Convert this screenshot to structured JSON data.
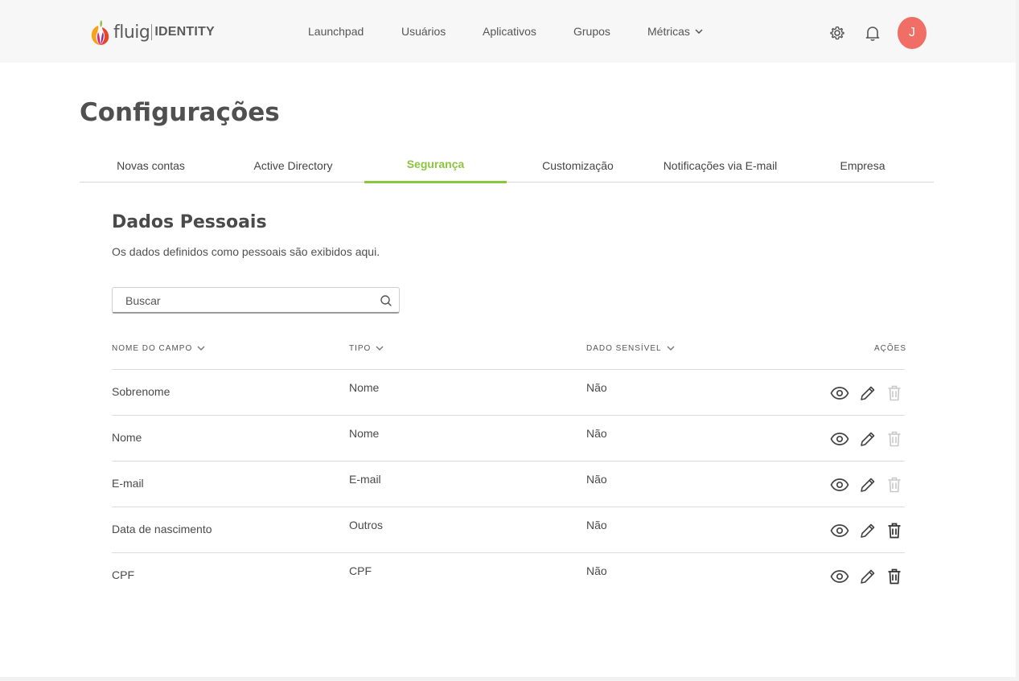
{
  "header": {
    "logo_text": "fluig",
    "logo_product": "IDENTITY",
    "nav": [
      {
        "label": "Launchpad"
      },
      {
        "label": "Usuários"
      },
      {
        "label": "Aplicativos"
      },
      {
        "label": "Grupos"
      },
      {
        "label": "Métricas"
      }
    ],
    "avatar_initial": "J",
    "avatar_color": "#f16e66"
  },
  "page": {
    "title": "Configurações",
    "tabs": [
      {
        "label": "Novas contas"
      },
      {
        "label": "Active Directory"
      },
      {
        "label": "Segurança",
        "active": true
      },
      {
        "label": "Customização"
      },
      {
        "label": "Notificações via E-mail"
      },
      {
        "label": "Empresa"
      }
    ]
  },
  "section": {
    "title": "Dados Pessoais",
    "description": "Os dados definidos como pessoais são exibidos aqui.",
    "search_placeholder": "Buscar"
  },
  "table": {
    "columns": [
      "NOME DO CAMPO",
      "TIPO",
      "DADO SENSÍVEL",
      "AÇÕES"
    ],
    "rows": [
      {
        "name": "Sobrenome",
        "tipo": "Nome",
        "sensivel": "Não",
        "delete_enabled": false
      },
      {
        "name": "Nome",
        "tipo": "Nome",
        "sensivel": "Não",
        "delete_enabled": false
      },
      {
        "name": "E-mail",
        "tipo": "E-mail",
        "sensivel": "Não",
        "delete_enabled": false
      },
      {
        "name": "Data de nascimento",
        "tipo": "Outros",
        "sensivel": "Não",
        "delete_enabled": true
      },
      {
        "name": "CPF",
        "tipo": "CPF",
        "sensivel": "Não",
        "delete_enabled": true
      }
    ]
  },
  "colors": {
    "accent": "#8cc540",
    "text": "#4a4a4a",
    "header_bg": "#f7f7f7"
  }
}
